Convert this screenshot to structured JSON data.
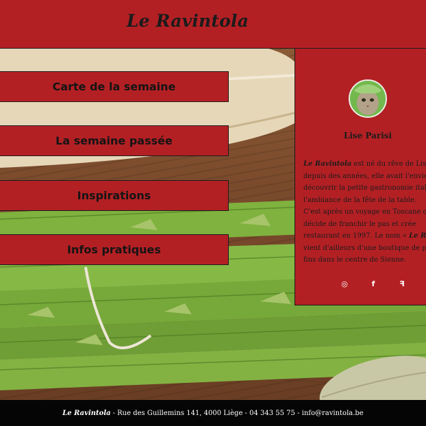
{
  "header": {
    "title": "Le Ravintola"
  },
  "menu": {
    "items": [
      {
        "label": "Carte de la semaine"
      },
      {
        "label": "La semaine passée"
      },
      {
        "label": "Inspirations"
      },
      {
        "label": "Infos pratiques"
      }
    ]
  },
  "profile": {
    "name": "Lise Parisi",
    "bio_lines": [
      {
        "brand": "Le Ravintola",
        "text": " est né du rêve de Lise Pa"
      },
      {
        "text": "depuis des années, elle avait l'envie de"
      },
      {
        "text": "découvrir la petite gastronomie italienn"
      },
      {
        "text": "l'ambiance de la fête de la table."
      },
      {
        "text": "C'est après un voyage en Toscane qu"
      },
      {
        "text": "décide de franchir le pas et crée"
      },
      {
        "text": "restaurant en 1997. Le nom « ",
        "brand": "Le Ravinto"
      },
      {
        "text": "vient d'ailleurs d'une boutique de prod"
      },
      {
        "text": "fins dans le centre de Sienne."
      }
    ],
    "social": [
      {
        "name": "instagram-icon",
        "glyph": "◎"
      },
      {
        "name": "facebook-icon",
        "glyph": "f"
      },
      {
        "name": "foursquare-icon",
        "glyph": "ꟻ"
      }
    ]
  },
  "footer": {
    "brand": "Le Ravintola",
    "text": " - Rue des Guillemins 141, 4000 Liège - 04 343 55 75 - info@ravintola.be"
  },
  "colors": {
    "accent": "#b32024",
    "footer": "#050505",
    "text": "#1b1b1b"
  }
}
